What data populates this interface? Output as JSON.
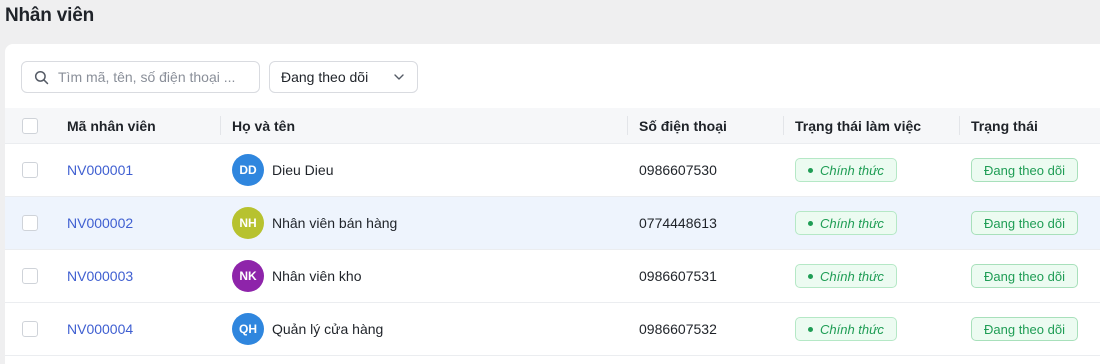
{
  "page": {
    "title": "Nhân viên"
  },
  "toolbar": {
    "search_placeholder": "Tìm mã, tên, số điện thoại ...",
    "search_icon": "search-icon",
    "filter_value": "Đang theo dõi",
    "filter_icon": "chevron-down-icon"
  },
  "table": {
    "headers": {
      "code": "Mã nhân viên",
      "name": "Họ và tên",
      "phone": "Số điện thoại",
      "work_status": "Trạng thái làm việc",
      "status": "Trạng thái"
    },
    "rows": [
      {
        "code": "NV000001",
        "initials": "DD",
        "avatar_color": "#2f86de",
        "name": "Dieu Dieu",
        "phone": "0986607530",
        "work_status": "Chính thức",
        "status": "Đang theo dõi"
      },
      {
        "code": "NV000002",
        "initials": "NH",
        "avatar_color": "#b7c22f",
        "name": "Nhân viên bán hàng",
        "phone": "0774448613",
        "work_status": "Chính thức",
        "status": "Đang theo dõi"
      },
      {
        "code": "NV000003",
        "initials": "NK",
        "avatar_color": "#8e24aa",
        "name": "Nhân viên kho",
        "phone": "0986607531",
        "work_status": "Chính thức",
        "status": "Đang theo dõi"
      },
      {
        "code": "NV000004",
        "initials": "QH",
        "avatar_color": "#2f86de",
        "name": "Quản lý cửa hàng",
        "phone": "0986607532",
        "work_status": "Chính thức",
        "status": "Đang theo dõi"
      }
    ]
  },
  "colors": {
    "link": "#3f5fd1",
    "badge_text": "#1f9d55",
    "badge_bg": "#ecfbf1",
    "row_highlight": "#eef4fd"
  }
}
